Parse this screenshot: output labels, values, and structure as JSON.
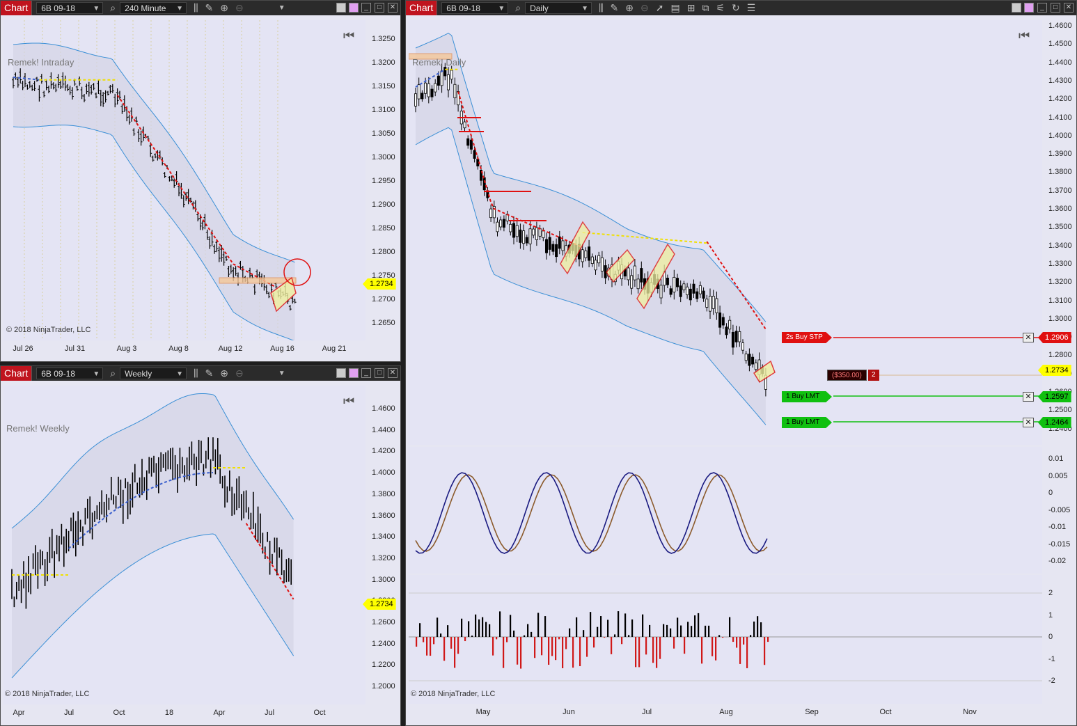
{
  "windows": {
    "intraday": {
      "chart_label": "Chart",
      "instrument": "6B 09-18",
      "period": "240 Minute",
      "title": "Remek! Intraday",
      "copyright": "© 2018 NinjaTrader, LLC",
      "price_tag": "1.2734",
      "y_ticks": [
        "1.3250",
        "1.3200",
        "1.3150",
        "1.3100",
        "1.3050",
        "1.3000",
        "1.2950",
        "1.2900",
        "1.2850",
        "1.2800",
        "1.2750",
        "1.2700",
        "1.2650"
      ],
      "x_ticks": [
        "Jul 26",
        "Jul 31",
        "Aug 3",
        "Aug 8",
        "Aug 12",
        "Aug 16",
        "Aug 21"
      ]
    },
    "weekly": {
      "chart_label": "Chart",
      "instrument": "6B 09-18",
      "period": "Weekly",
      "title": "Remek! Weekly",
      "copyright": "© 2018 NinjaTrader, LLC",
      "price_tag": "1.2734",
      "y_ticks": [
        "1.4600",
        "1.4400",
        "1.4200",
        "1.4000",
        "1.3800",
        "1.3600",
        "1.3400",
        "1.3200",
        "1.3000",
        "1.2800",
        "1.2600",
        "1.2400",
        "1.2200",
        "1.2000"
      ],
      "x_ticks": [
        "Apr",
        "Jul",
        "Oct",
        "18",
        "Apr",
        "Jul",
        "Oct"
      ]
    },
    "daily": {
      "chart_label": "Chart",
      "instrument": "6B 09-18",
      "period": "Daily",
      "title": "Remek! Daily",
      "copyright": "© 2018 NinjaTrader, LLC",
      "price_tag": "1.2734",
      "y_ticks": [
        "1.4600",
        "1.4500",
        "1.4400",
        "1.4300",
        "1.4200",
        "1.4100",
        "1.4000",
        "1.3900",
        "1.3800",
        "1.3700",
        "1.3600",
        "1.3500",
        "1.3400",
        "1.3300",
        "1.3200",
        "1.3100",
        "1.3000",
        "1.2900",
        "1.2800",
        "1.2700",
        "1.2600",
        "1.2500",
        "1.2400"
      ],
      "osc_ticks": [
        "0.01",
        "0.005",
        "0",
        "-0.005",
        "-0.01",
        "-0.015",
        "-0.02"
      ],
      "hist_ticks": [
        "2",
        "1",
        "0",
        "-1",
        "-2"
      ],
      "x_ticks": [
        "May",
        "Jun",
        "Jul",
        "Aug",
        "Sep",
        "Oct",
        "Nov"
      ],
      "orders": [
        {
          "label": "2s  Buy STP",
          "price": "1.2906",
          "color": "#e01010"
        },
        {
          "label": "1  Buy LMT",
          "price": "1.2597",
          "color": "#10c010"
        },
        {
          "label": "1  Buy LMT",
          "price": "1.2464",
          "color": "#10c010"
        }
      ],
      "position": {
        "pnl": "($350.00)",
        "qty": "2"
      }
    }
  },
  "colors": {
    "band": "#3a8fd6",
    "ma_down": "#e01010",
    "ma_up": "#3a5fcd",
    "flat": "#f0e000",
    "osc_fast": "#1a1a80",
    "osc_slow": "#8b5a2b"
  }
}
